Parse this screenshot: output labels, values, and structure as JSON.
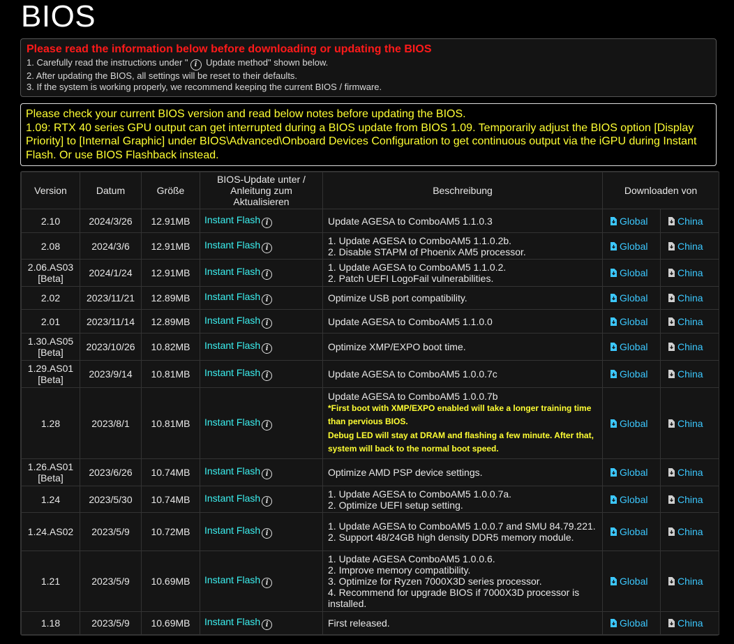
{
  "page": {
    "title": "BIOS"
  },
  "notice": {
    "heading": "Please read the information below before downloading or updating the BIOS",
    "line1_prefix": "1. Carefully read the instructions under \"",
    "line1_suffix": " Update method\" shown below.",
    "line2": "2. After updating the BIOS, all settings will be reset to their defaults.",
    "line3": "3. If the system is working properly, we recommend keeping the current BIOS / firmware."
  },
  "warning": {
    "line1": "Please check your current BIOS version and read below notes before updating the BIOS.",
    "line2": "1.09: RTX 40 series GPU output can get interrupted during a BIOS update from BIOS 1.09. Temporarily adjust the BIOS option [Display Priority] to [Internal Graphic] under BIOS\\Advanced\\Onboard Devices Configuration to get continuous output via the iGPU during Instant Flash. Or use BIOS Flashback instead."
  },
  "table": {
    "headers": {
      "version": "Version",
      "date": "Datum",
      "size": "Größe",
      "update": "BIOS-Update unter / Anleitung zum Aktualisieren",
      "description": "Beschreibung",
      "download": "Downloaden von"
    },
    "flash_label": "Instant Flash",
    "global_label": "Global",
    "china_label": "China",
    "colors": {
      "flash": "#3cf0f0",
      "link": "#3cc8ff",
      "warning": "#ffff33",
      "alert": "#ff1a1a"
    },
    "rows": [
      {
        "version": "2.10",
        "date": "2024/3/26",
        "size": "12.91MB",
        "desc": [
          "Update AGESA to ComboAM5 1.1.0.3"
        ]
      },
      {
        "version": "2.08",
        "date": "2024/3/6",
        "size": "12.91MB",
        "desc": [
          "1. Update AGESA to ComboAM5 1.1.0.2b.",
          "2. Disable STAPM of Phoenix AM5 processor."
        ]
      },
      {
        "version": "2.06.AS03 [Beta]",
        "date": "2024/1/24",
        "size": "12.91MB",
        "desc": [
          "1. Update AGESA to ComboAM5 1.1.0.2.",
          "2. Patch UEFI LogoFail vulnerabilities."
        ]
      },
      {
        "version": "2.02",
        "date": "2023/11/21",
        "size": "12.89MB",
        "desc": [
          "Optimize USB port compatibility."
        ]
      },
      {
        "version": "2.01",
        "date": "2023/11/14",
        "size": "12.89MB",
        "desc": [
          "Update AGESA to ComboAM5 1.1.0.0"
        ]
      },
      {
        "version": "1.30.AS05 [Beta]",
        "date": "2023/10/26",
        "size": "10.82MB",
        "desc": [
          "Optimize XMP/EXPO boot time."
        ]
      },
      {
        "version": "1.29.AS01 [Beta]",
        "date": "2023/9/14",
        "size": "10.81MB",
        "desc": [
          "Update AGESA to ComboAM5 1.0.0.7c"
        ]
      },
      {
        "version": "1.28",
        "date": "2023/8/1",
        "size": "10.81MB",
        "desc": [
          "Update AGESA to ComboAM5 1.0.0.7b"
        ],
        "notes": [
          "*First boot with XMP/EXPO enabled will take a longer training time than pervious BIOS.",
          "Debug LED will stay at DRAM and flashing a few minute. After that, system will back to the normal boot speed."
        ]
      },
      {
        "version": "1.26.AS01 [Beta]",
        "date": "2023/6/26",
        "size": "10.74MB",
        "desc": [
          "Optimize AMD PSP device settings."
        ]
      },
      {
        "version": "1.24",
        "date": "2023/5/30",
        "size": "10.74MB",
        "desc": [
          "1. Update AGESA to ComboAM5 1.0.0.7a.",
          "2. Optimize UEFI setup setting."
        ]
      },
      {
        "version": "1.24.AS02",
        "date": "2023/5/9",
        "size": "10.72MB",
        "desc": [
          "1. Update AGESA to ComboAM5 1.0.0.7 and SMU 84.79.221.",
          "2. Support 48/24GB high density DDR5 memory module."
        ]
      },
      {
        "version": "1.21",
        "date": "2023/5/9",
        "size": "10.69MB",
        "desc": [
          "1. Update AGESA ComboAM5 1.0.0.6.",
          "2. Improve memory compatibility.",
          "3. Optimize for Ryzen 7000X3D series processor.",
          "4. Recommend for upgrade BIOS if 7000X3D processor is installed."
        ]
      },
      {
        "version": "1.18",
        "date": "2023/5/9",
        "size": "10.69MB",
        "desc": [
          "First released."
        ]
      }
    ]
  }
}
